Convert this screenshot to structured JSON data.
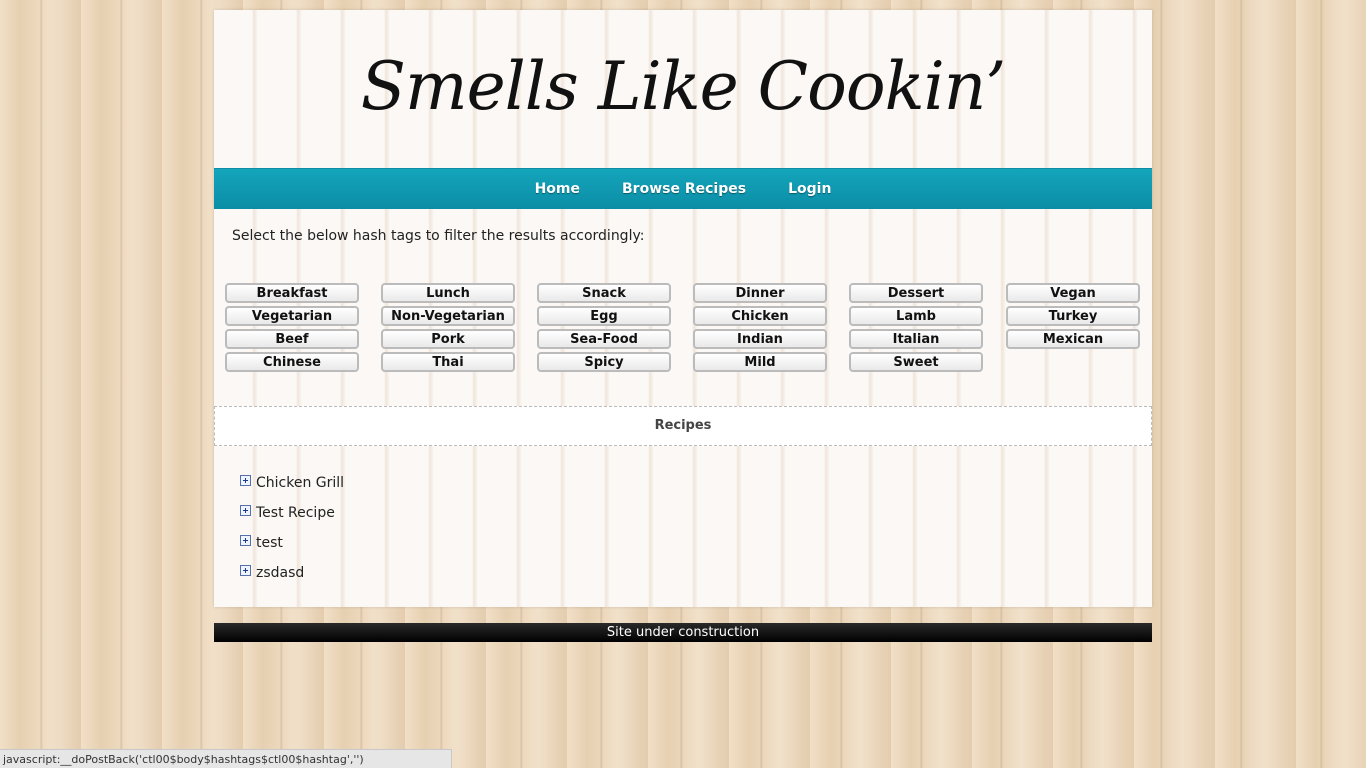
{
  "site": {
    "title": "Smells Like Cookin’"
  },
  "nav": [
    "Home",
    "Browse Recipes",
    "Login"
  ],
  "filter": {
    "instructions": "Select the below hash tags to filter the results accordingly:",
    "hashtags": [
      [
        "Breakfast",
        "Lunch",
        "Snack",
        "Dinner",
        "Dessert",
        "Vegan"
      ],
      [
        "Vegetarian",
        "Non-Vegetarian",
        "Egg",
        "Chicken",
        "Lamb",
        "Turkey"
      ],
      [
        "Beef",
        "Pork",
        "Sea-Food",
        "Indian",
        "Italian",
        "Mexican"
      ],
      [
        "Chinese",
        "Thai",
        "Spicy",
        "Mild",
        "Sweet"
      ]
    ]
  },
  "recipes": {
    "header": "Recipes",
    "items": [
      "Chicken Grill",
      "Test Recipe",
      "test",
      "zsdasd"
    ]
  },
  "footer": {
    "text": "Site under construction"
  },
  "status_bar": {
    "text": "javascript:__doPostBack('ctl00$body$hashtags$ctl00$hashtag','')"
  },
  "colors": {
    "nav_bg": "#0f9bb2",
    "footer_bg": "#000000",
    "page_bg": "#ead6bb"
  }
}
